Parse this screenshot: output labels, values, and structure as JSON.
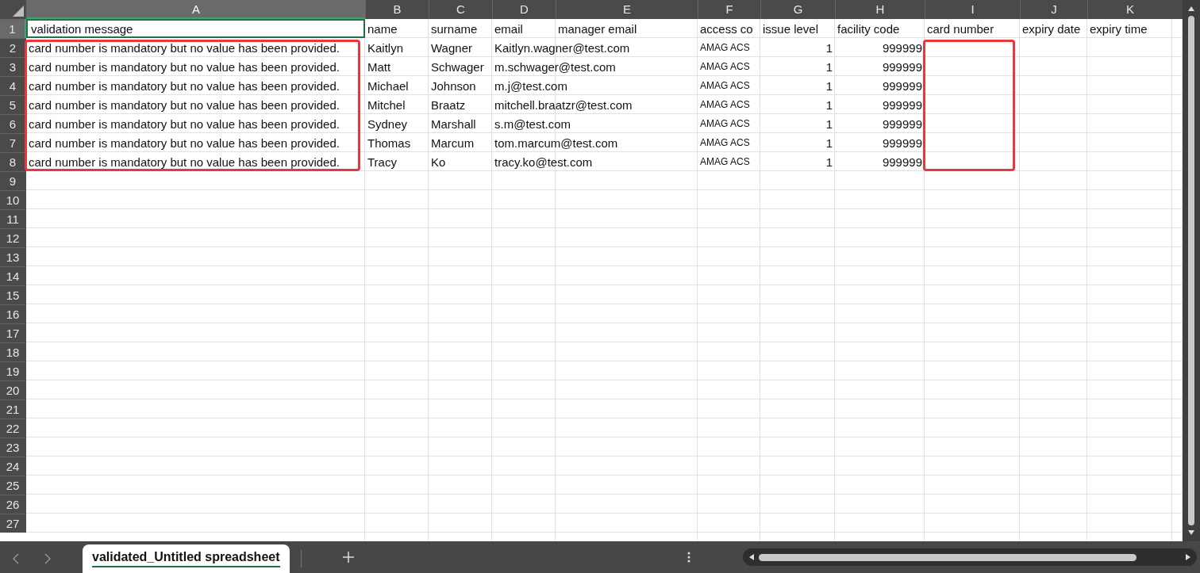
{
  "columns": [
    {
      "letter": "A",
      "highlighted": true,
      "selected": true
    },
    {
      "letter": "B",
      "highlighted": false,
      "selected": false
    },
    {
      "letter": "C",
      "highlighted": false,
      "selected": false
    },
    {
      "letter": "D",
      "highlighted": false,
      "selected": false
    },
    {
      "letter": "E",
      "highlighted": false,
      "selected": false
    },
    {
      "letter": "F",
      "highlighted": false,
      "selected": false
    },
    {
      "letter": "G",
      "highlighted": false,
      "selected": false
    },
    {
      "letter": "H",
      "highlighted": false,
      "selected": false
    },
    {
      "letter": "I",
      "highlighted": true,
      "selected": false
    },
    {
      "letter": "J",
      "highlighted": false,
      "selected": false
    },
    {
      "letter": "K",
      "highlighted": false,
      "selected": false
    }
  ],
  "rows": [
    {
      "number": "1",
      "selected": true,
      "cells": {
        "A": {
          "kind": "text",
          "text": "validation message"
        },
        "B": {
          "kind": "text",
          "text": "name"
        },
        "C": {
          "kind": "text",
          "text": "surname"
        },
        "D": {
          "kind": "text",
          "text": "email"
        },
        "E": {
          "kind": "text",
          "text": "manager email"
        },
        "F": {
          "kind": "text",
          "text": "access co"
        },
        "G": {
          "kind": "text",
          "text": "issue level"
        },
        "H": {
          "kind": "text",
          "text": "facility code"
        },
        "I": {
          "kind": "text",
          "text": "card number"
        },
        "J": {
          "kind": "text",
          "text": "expiry date"
        },
        "K": {
          "kind": "text",
          "text": "expiry time"
        }
      }
    },
    {
      "number": "2",
      "selected": false,
      "cells": {
        "A": {
          "kind": "text",
          "text": "card number is mandatory but no value has been provided."
        },
        "B": {
          "kind": "text",
          "text": "Kaitlyn"
        },
        "C": {
          "kind": "text",
          "text": "Wagner"
        },
        "D": {
          "kind": "text",
          "text": "Kaitlyn.wagner@test.com"
        },
        "F": {
          "kind": "tag",
          "text": "AMAG ACS"
        },
        "G": {
          "kind": "number",
          "text": "1"
        },
        "H": {
          "kind": "number",
          "text": "999999"
        }
      }
    },
    {
      "number": "3",
      "selected": false,
      "cells": {
        "A": {
          "kind": "text",
          "text": "card number is mandatory but no value has been provided."
        },
        "B": {
          "kind": "text",
          "text": "Matt"
        },
        "C": {
          "kind": "text",
          "text": "Schwager"
        },
        "D": {
          "kind": "text",
          "text": "m.schwager@test.com"
        },
        "F": {
          "kind": "tag",
          "text": "AMAG ACS"
        },
        "G": {
          "kind": "number",
          "text": "1"
        },
        "H": {
          "kind": "number",
          "text": "999999"
        }
      }
    },
    {
      "number": "4",
      "selected": false,
      "cells": {
        "A": {
          "kind": "text",
          "text": "card number is mandatory but no value has been provided."
        },
        "B": {
          "kind": "text",
          "text": "Michael"
        },
        "C": {
          "kind": "text",
          "text": "Johnson"
        },
        "D": {
          "kind": "text",
          "text": "m.j@test.com"
        },
        "F": {
          "kind": "tag",
          "text": "AMAG ACS"
        },
        "G": {
          "kind": "number",
          "text": "1"
        },
        "H": {
          "kind": "number",
          "text": "999999"
        }
      }
    },
    {
      "number": "5",
      "selected": false,
      "cells": {
        "A": {
          "kind": "text",
          "text": "card number is mandatory but no value has been provided."
        },
        "B": {
          "kind": "text",
          "text": "Mitchel"
        },
        "C": {
          "kind": "text",
          "text": "Braatz"
        },
        "D": {
          "kind": "text",
          "text": "mitchell.braatzr@test.com"
        },
        "F": {
          "kind": "tag",
          "text": "AMAG ACS"
        },
        "G": {
          "kind": "number",
          "text": "1"
        },
        "H": {
          "kind": "number",
          "text": "999999"
        }
      }
    },
    {
      "number": "6",
      "selected": false,
      "cells": {
        "A": {
          "kind": "text",
          "text": "card number is mandatory but no value has been provided."
        },
        "B": {
          "kind": "text",
          "text": "Sydney"
        },
        "C": {
          "kind": "text",
          "text": "Marshall"
        },
        "D": {
          "kind": "text",
          "text": "s.m@test.com"
        },
        "F": {
          "kind": "tag",
          "text": "AMAG ACS"
        },
        "G": {
          "kind": "number",
          "text": "1"
        },
        "H": {
          "kind": "number",
          "text": "999999"
        }
      }
    },
    {
      "number": "7",
      "selected": false,
      "cells": {
        "A": {
          "kind": "text",
          "text": "card number is mandatory but no value has been provided."
        },
        "B": {
          "kind": "text",
          "text": "Thomas"
        },
        "C": {
          "kind": "text",
          "text": "Marcum"
        },
        "D": {
          "kind": "text",
          "text": "tom.marcum@test.com"
        },
        "F": {
          "kind": "tag",
          "text": "AMAG ACS"
        },
        "G": {
          "kind": "number",
          "text": "1"
        },
        "H": {
          "kind": "number",
          "text": "999999"
        }
      }
    },
    {
      "number": "8",
      "selected": false,
      "cells": {
        "A": {
          "kind": "text",
          "text": "card number is mandatory but no value has been provided."
        },
        "B": {
          "kind": "text",
          "text": "Tracy"
        },
        "C": {
          "kind": "text",
          "text": "Ko"
        },
        "D": {
          "kind": "text",
          "text": "tracy.ko@test.com"
        },
        "F": {
          "kind": "tag",
          "text": "AMAG ACS"
        },
        "G": {
          "kind": "number",
          "text": "1"
        },
        "H": {
          "kind": "number",
          "text": "999999"
        }
      }
    },
    {
      "number": "9",
      "selected": false
    },
    {
      "number": "10",
      "selected": false
    },
    {
      "number": "11",
      "selected": false
    },
    {
      "number": "12",
      "selected": false
    },
    {
      "number": "13",
      "selected": false
    },
    {
      "number": "14",
      "selected": false
    },
    {
      "number": "15",
      "selected": false
    },
    {
      "number": "16",
      "selected": false
    },
    {
      "number": "17",
      "selected": false
    },
    {
      "number": "18",
      "selected": false
    },
    {
      "number": "19",
      "selected": false
    },
    {
      "number": "20",
      "selected": false
    },
    {
      "number": "21",
      "selected": false
    },
    {
      "number": "22",
      "selected": false
    },
    {
      "number": "23",
      "selected": false
    },
    {
      "number": "24",
      "selected": false
    },
    {
      "number": "25",
      "selected": false
    },
    {
      "number": "26",
      "selected": false
    },
    {
      "number": "27",
      "selected": false
    }
  ],
  "sheet_tabs": [
    {
      "label": "validated_Untitled spreadsheet",
      "selected": true
    }
  ]
}
